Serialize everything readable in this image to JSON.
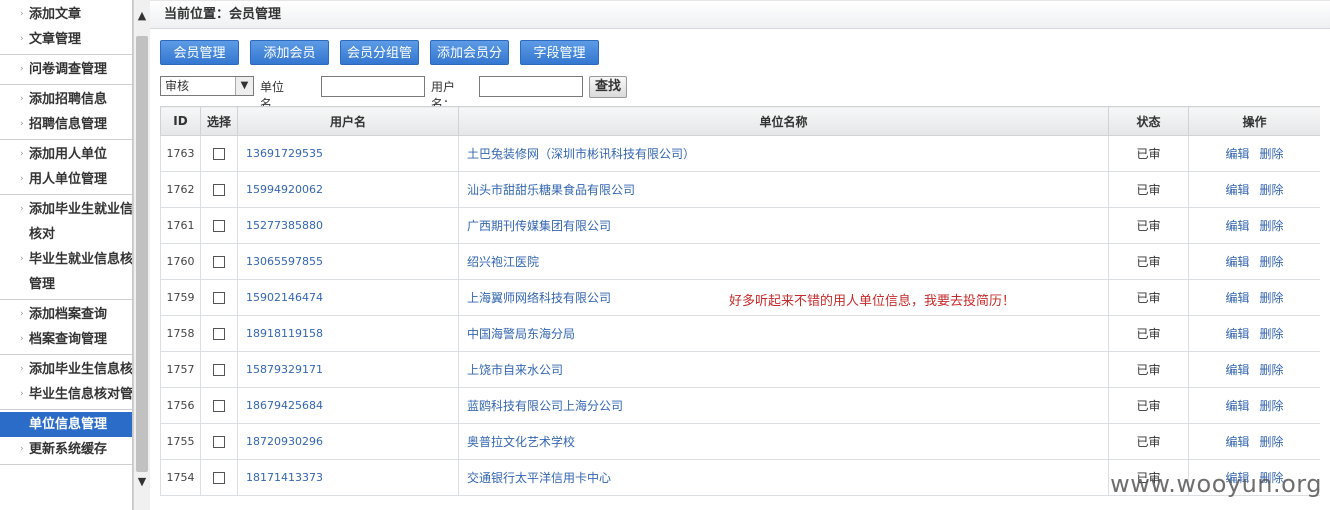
{
  "sidebar": {
    "groups": [
      {
        "items": [
          {
            "label": "添加文章"
          },
          {
            "label": "文章管理"
          }
        ]
      },
      {
        "items": [
          {
            "label": "问卷调查管理"
          }
        ]
      },
      {
        "items": [
          {
            "label": "添加招聘信息"
          },
          {
            "label": "招聘信息管理"
          }
        ]
      },
      {
        "items": [
          {
            "label": "添加用人单位"
          },
          {
            "label": "用人单位管理"
          }
        ]
      },
      {
        "items": [
          {
            "label": "添加毕业生就业信息"
          },
          {
            "label": "核对"
          },
          {
            "label": "毕业生就业信息核对"
          },
          {
            "label": "管理"
          }
        ]
      },
      {
        "items": [
          {
            "label": "添加档案查询"
          },
          {
            "label": "档案查询管理"
          }
        ]
      },
      {
        "items": [
          {
            "label": "添加毕业生信息核对"
          },
          {
            "label": "毕业生信息核对管理"
          }
        ]
      },
      {
        "items": [
          {
            "label": "单位信息管理",
            "active": true
          },
          {
            "label": "更新系统缓存"
          }
        ]
      }
    ],
    "scroll_up_icon": "chevron-up-icon",
    "scroll_down_icon": "chevron-down-icon"
  },
  "breadcrumb": "当前位置：会员管理",
  "toolbar": {
    "buttons": [
      "会员管理",
      "添加会员",
      "会员分组管理",
      "添加会员分组",
      "字段管理"
    ]
  },
  "filter": {
    "status_value": "审核",
    "unit_label": "单位名称：",
    "user_label": "用户名：",
    "search_label": "查找"
  },
  "table": {
    "headers": [
      "ID",
      "选择",
      "用户名",
      "单位名称",
      "状态",
      "操作"
    ],
    "edit_label": "编辑",
    "delete_label": "删除",
    "rows": [
      {
        "id": "1763",
        "user": "13691729535",
        "company": "土巴兔装修网（深圳市彬讯科技有限公司）",
        "status": "已审"
      },
      {
        "id": "1762",
        "user": "15994920062",
        "company": "汕头市甜甜乐糖果食品有限公司",
        "status": "已审"
      },
      {
        "id": "1761",
        "user": "15277385880",
        "company": "广西期刊传媒集团有限公司",
        "status": "已审"
      },
      {
        "id": "1760",
        "user": "13065597855",
        "company": "绍兴袍江医院",
        "status": "已审"
      },
      {
        "id": "1759",
        "user": "15902146474",
        "company": "上海翼师网络科技有限公司",
        "status": "已审"
      },
      {
        "id": "1758",
        "user": "18918119158",
        "company": "中国海警局东海分局",
        "status": "已审"
      },
      {
        "id": "1757",
        "user": "15879329171",
        "company": "上饶市自来水公司",
        "status": "已审"
      },
      {
        "id": "1756",
        "user": "18679425684",
        "company": "蓝鸥科技有限公司上海分公司",
        "status": "已审"
      },
      {
        "id": "1755",
        "user": "18720930296",
        "company": "奥普拉文化艺术学校",
        "status": "已审"
      },
      {
        "id": "1754",
        "user": "18171413373",
        "company": "交通银行太平洋信用卡中心",
        "status": "已审"
      }
    ]
  },
  "annotation": "好多听起来不错的用人单位信息，我要去投简历！",
  "watermark": "www.wooyun.org"
}
